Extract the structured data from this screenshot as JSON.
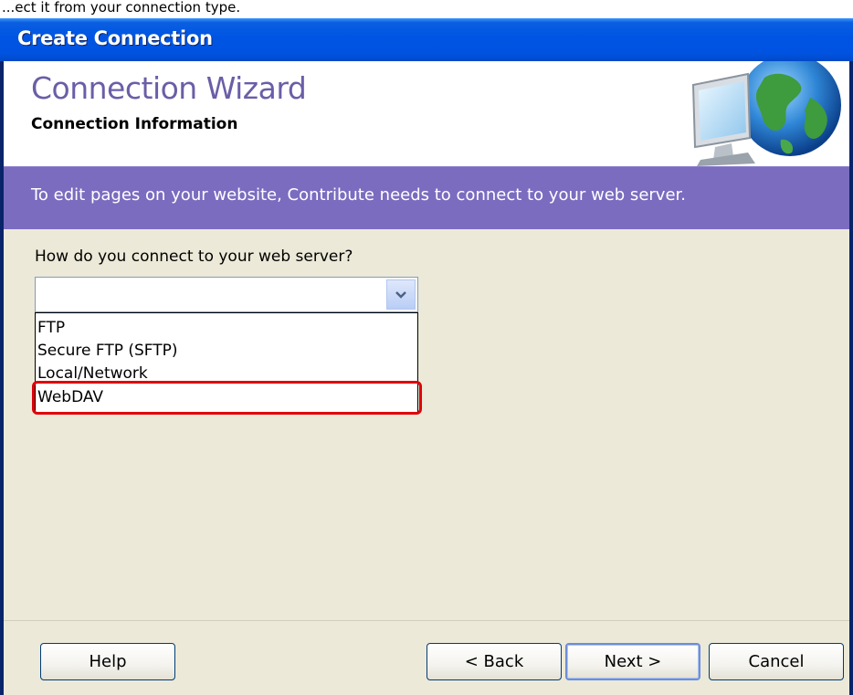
{
  "top_caption": "...ect it from your connection type.",
  "window": {
    "title": "Create Connection"
  },
  "header": {
    "title": "Connection Wizard",
    "subtitle": "Connection Information",
    "icon": "globe-monitor-icon"
  },
  "banner": {
    "text": "To edit pages on your website, Contribute needs to connect to your web server."
  },
  "form": {
    "question": "How do you connect to your web server?",
    "select_value": "",
    "options": [
      "FTP",
      "Secure FTP (SFTP)",
      "Local/Network",
      "WebDAV"
    ],
    "highlighted_option": "WebDAV",
    "highlight_color": "#e0000a"
  },
  "buttons": {
    "help": "Help",
    "back": "< Back",
    "next": "Next >",
    "cancel": "Cancel"
  },
  "colors": {
    "titlebar": "#0054e3",
    "wizard_title": "#6a5ea8",
    "banner": "#7b6cc0",
    "client_bg": "#ece9d8"
  }
}
